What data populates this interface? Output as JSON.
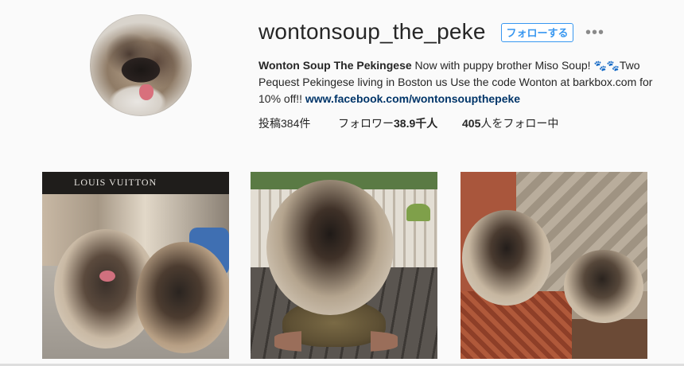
{
  "profile": {
    "username": "wontonsoup_the_peke",
    "follow_label": "フォローする",
    "more_label": "•••",
    "bio_name": "Wonton Soup The Pekingese",
    "bio_text": " Now with puppy brother Miso Soup! ",
    "bio_emoji": "🐾🐾",
    "bio_text2": "Two Pequest Pekingese living in Boston us Use the code Wonton at barkbox.com for 10% off!! ",
    "bio_link": "www.facebook.com/wontonsoupthepeke"
  },
  "stats": {
    "posts": "投稿384件",
    "followers_prefix": "フォロワー",
    "followers_value": "38.9千人",
    "following_value": "405",
    "following_suffix": "人をフォロー中"
  },
  "photos": [
    {
      "store_sign": "LOUIS VUITTON"
    },
    {
      "id": "p2"
    },
    {
      "id": "p3"
    }
  ],
  "colors": {
    "accent": "#3897f0",
    "link": "#003569",
    "background": "#fafafa"
  }
}
